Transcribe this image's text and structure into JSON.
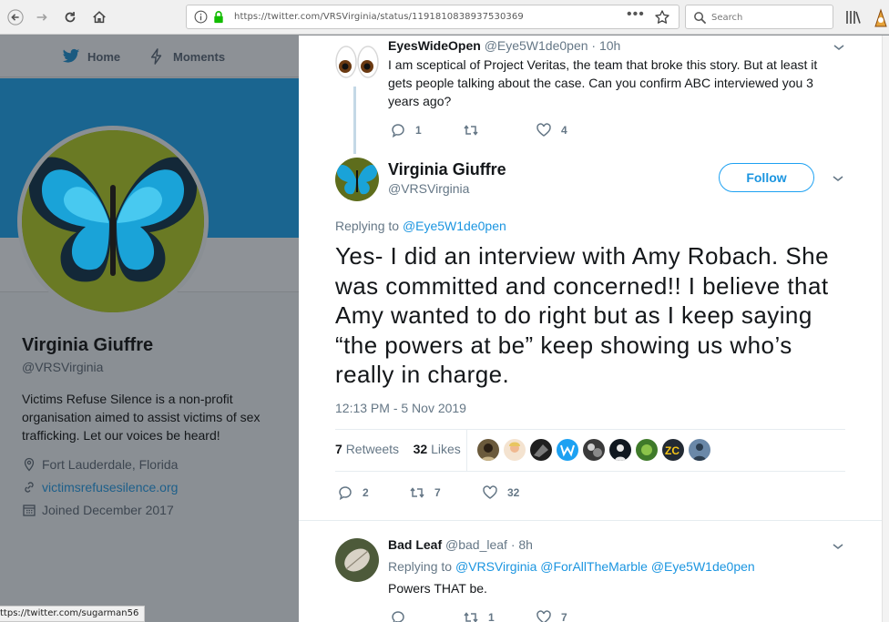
{
  "browser": {
    "url": "https://twitter.com/VRSVirginia/status/1191810838937530369",
    "search_placeholder": "Search",
    "status_link": "ttps://twitter.com/sugarman56"
  },
  "twitter_nav": {
    "home_label": "Home",
    "moments_label": "Moments"
  },
  "profile": {
    "name": "Virginia Giuffre",
    "handle": "@VRSVirginia",
    "bio": "Victims Refuse Silence is a non-profit organisation aimed to assist victims of sex trafficking. Let our voices be heard!",
    "location": "Fort Lauderdale, Florida",
    "website": "victimsrefusesilence.org",
    "joined": "Joined December 2017"
  },
  "parent_tweet": {
    "name": "EyesWideOpen",
    "handle": "@Eye5W1de0pen",
    "time": "· 10h",
    "text": "I am sceptical of Project Veritas, the team that broke this story. But at least it gets people talking about the case. Can you confirm ABC interviewed you 3 years ago?",
    "replies": "1",
    "retweets": "",
    "likes": "4"
  },
  "main_tweet": {
    "name": "Virginia Giuffre",
    "handle": "@VRSVirginia",
    "follow_label": "Follow",
    "replying_prefix": "Replying to",
    "replying_to": "@Eye5W1de0pen",
    "text": "Yes- I did an interview with Amy Robach. She was committed and concerned!! I believe that Amy wanted to do right but as I keep saying “the powers at be” keep showing us who’s really in charge.",
    "timestamp": "12:13 PM - 5 Nov 2019",
    "retweet_count": "7",
    "retweet_label": "Retweets",
    "like_count": "32",
    "like_label": "Likes",
    "replies": "2",
    "retweets": "7",
    "likes": "32"
  },
  "reply_tweet": {
    "name": "Bad Leaf",
    "handle": "@bad_leaf",
    "time": "· 8h",
    "replying_prefix": "Replying to",
    "mentions": "@VRSVirginia @ForAllTheMarble @Eye5W1de0pen",
    "text": "Powers THAT be.",
    "retweets": "1",
    "likes": "7"
  },
  "colors": {
    "twitter_blue": "#1da1f2",
    "link_blue": "#1b95e0",
    "banner": "#1a6590",
    "overlay_gray": "#8a8f94"
  }
}
